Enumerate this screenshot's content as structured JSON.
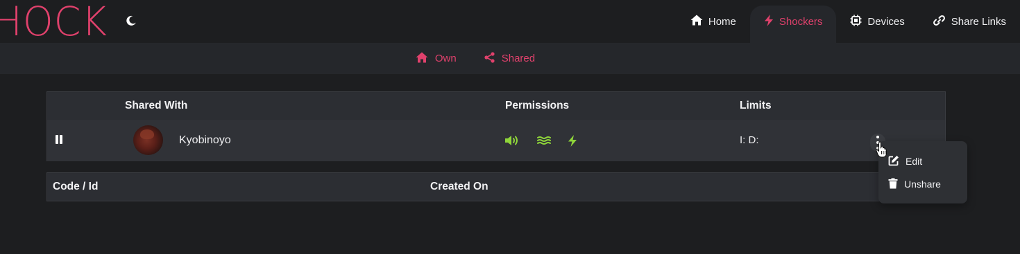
{
  "header": {
    "logo_text": "HOCK",
    "nav": [
      {
        "label": "Home",
        "icon": "home-icon",
        "active": false
      },
      {
        "label": "Shockers",
        "icon": "bolt-icon",
        "active": true
      },
      {
        "label": "Devices",
        "icon": "chip-icon",
        "active": false
      },
      {
        "label": "Share Links",
        "icon": "link-icon",
        "active": false
      }
    ]
  },
  "subnav": {
    "tabs": [
      {
        "label": "Own",
        "icon": "home-icon"
      },
      {
        "label": "Shared",
        "icon": "share-icon"
      }
    ]
  },
  "shares_table": {
    "columns": [
      "Shared With",
      "Permissions",
      "Limits"
    ],
    "rows": [
      {
        "username": "Kyobinoyo",
        "permissions": [
          "sound-icon",
          "vibrate-icon",
          "shock-icon"
        ],
        "limits": "I: D:"
      }
    ]
  },
  "codes_table": {
    "columns": [
      "Code / Id",
      "Created On"
    ]
  },
  "context_menu": {
    "items": [
      {
        "label": "Edit",
        "icon": "edit-icon"
      },
      {
        "label": "Unshare",
        "icon": "trash-icon"
      }
    ]
  },
  "colors": {
    "accent": "#e0416c",
    "permission_green": "#8fd63a",
    "background": "#1d1e20",
    "panel": "#25272b"
  }
}
